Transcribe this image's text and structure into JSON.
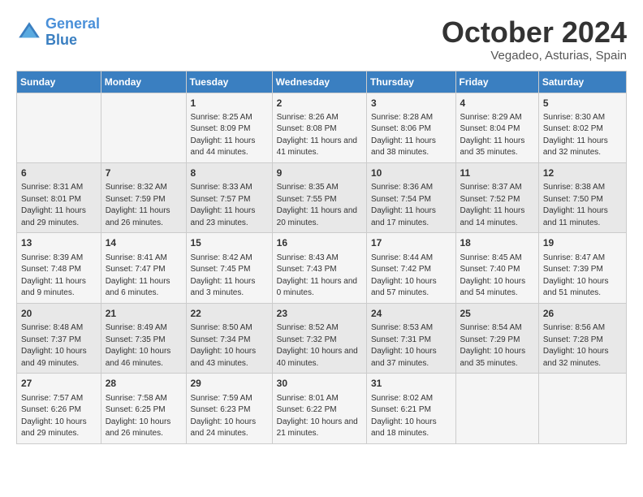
{
  "header": {
    "logo_line1": "General",
    "logo_line2": "Blue",
    "month": "October 2024",
    "location": "Vegadeo, Asturias, Spain"
  },
  "days_of_week": [
    "Sunday",
    "Monday",
    "Tuesday",
    "Wednesday",
    "Thursday",
    "Friday",
    "Saturday"
  ],
  "weeks": [
    [
      {
        "day": "",
        "content": ""
      },
      {
        "day": "",
        "content": ""
      },
      {
        "day": "1",
        "content": "Sunrise: 8:25 AM\nSunset: 8:09 PM\nDaylight: 11 hours and 44 minutes."
      },
      {
        "day": "2",
        "content": "Sunrise: 8:26 AM\nSunset: 8:08 PM\nDaylight: 11 hours and 41 minutes."
      },
      {
        "day": "3",
        "content": "Sunrise: 8:28 AM\nSunset: 8:06 PM\nDaylight: 11 hours and 38 minutes."
      },
      {
        "day": "4",
        "content": "Sunrise: 8:29 AM\nSunset: 8:04 PM\nDaylight: 11 hours and 35 minutes."
      },
      {
        "day": "5",
        "content": "Sunrise: 8:30 AM\nSunset: 8:02 PM\nDaylight: 11 hours and 32 minutes."
      }
    ],
    [
      {
        "day": "6",
        "content": "Sunrise: 8:31 AM\nSunset: 8:01 PM\nDaylight: 11 hours and 29 minutes."
      },
      {
        "day": "7",
        "content": "Sunrise: 8:32 AM\nSunset: 7:59 PM\nDaylight: 11 hours and 26 minutes."
      },
      {
        "day": "8",
        "content": "Sunrise: 8:33 AM\nSunset: 7:57 PM\nDaylight: 11 hours and 23 minutes."
      },
      {
        "day": "9",
        "content": "Sunrise: 8:35 AM\nSunset: 7:55 PM\nDaylight: 11 hours and 20 minutes."
      },
      {
        "day": "10",
        "content": "Sunrise: 8:36 AM\nSunset: 7:54 PM\nDaylight: 11 hours and 17 minutes."
      },
      {
        "day": "11",
        "content": "Sunrise: 8:37 AM\nSunset: 7:52 PM\nDaylight: 11 hours and 14 minutes."
      },
      {
        "day": "12",
        "content": "Sunrise: 8:38 AM\nSunset: 7:50 PM\nDaylight: 11 hours and 11 minutes."
      }
    ],
    [
      {
        "day": "13",
        "content": "Sunrise: 8:39 AM\nSunset: 7:48 PM\nDaylight: 11 hours and 9 minutes."
      },
      {
        "day": "14",
        "content": "Sunrise: 8:41 AM\nSunset: 7:47 PM\nDaylight: 11 hours and 6 minutes."
      },
      {
        "day": "15",
        "content": "Sunrise: 8:42 AM\nSunset: 7:45 PM\nDaylight: 11 hours and 3 minutes."
      },
      {
        "day": "16",
        "content": "Sunrise: 8:43 AM\nSunset: 7:43 PM\nDaylight: 11 hours and 0 minutes."
      },
      {
        "day": "17",
        "content": "Sunrise: 8:44 AM\nSunset: 7:42 PM\nDaylight: 10 hours and 57 minutes."
      },
      {
        "day": "18",
        "content": "Sunrise: 8:45 AM\nSunset: 7:40 PM\nDaylight: 10 hours and 54 minutes."
      },
      {
        "day": "19",
        "content": "Sunrise: 8:47 AM\nSunset: 7:39 PM\nDaylight: 10 hours and 51 minutes."
      }
    ],
    [
      {
        "day": "20",
        "content": "Sunrise: 8:48 AM\nSunset: 7:37 PM\nDaylight: 10 hours and 49 minutes."
      },
      {
        "day": "21",
        "content": "Sunrise: 8:49 AM\nSunset: 7:35 PM\nDaylight: 10 hours and 46 minutes."
      },
      {
        "day": "22",
        "content": "Sunrise: 8:50 AM\nSunset: 7:34 PM\nDaylight: 10 hours and 43 minutes."
      },
      {
        "day": "23",
        "content": "Sunrise: 8:52 AM\nSunset: 7:32 PM\nDaylight: 10 hours and 40 minutes."
      },
      {
        "day": "24",
        "content": "Sunrise: 8:53 AM\nSunset: 7:31 PM\nDaylight: 10 hours and 37 minutes."
      },
      {
        "day": "25",
        "content": "Sunrise: 8:54 AM\nSunset: 7:29 PM\nDaylight: 10 hours and 35 minutes."
      },
      {
        "day": "26",
        "content": "Sunrise: 8:56 AM\nSunset: 7:28 PM\nDaylight: 10 hours and 32 minutes."
      }
    ],
    [
      {
        "day": "27",
        "content": "Sunrise: 7:57 AM\nSunset: 6:26 PM\nDaylight: 10 hours and 29 minutes."
      },
      {
        "day": "28",
        "content": "Sunrise: 7:58 AM\nSunset: 6:25 PM\nDaylight: 10 hours and 26 minutes."
      },
      {
        "day": "29",
        "content": "Sunrise: 7:59 AM\nSunset: 6:23 PM\nDaylight: 10 hours and 24 minutes."
      },
      {
        "day": "30",
        "content": "Sunrise: 8:01 AM\nSunset: 6:22 PM\nDaylight: 10 hours and 21 minutes."
      },
      {
        "day": "31",
        "content": "Sunrise: 8:02 AM\nSunset: 6:21 PM\nDaylight: 10 hours and 18 minutes."
      },
      {
        "day": "",
        "content": ""
      },
      {
        "day": "",
        "content": ""
      }
    ]
  ]
}
